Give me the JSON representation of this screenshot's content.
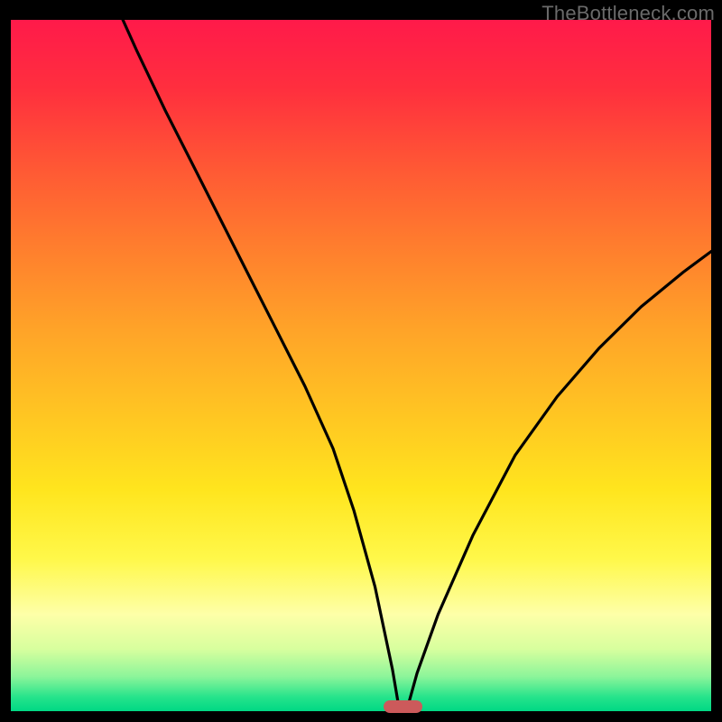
{
  "watermark": "TheBottleneck.com",
  "chart_data": {
    "type": "line",
    "title": "",
    "xlabel": "",
    "ylabel": "",
    "series": [
      {
        "name": "bottleneck-curve",
        "x": [
          0.0,
          0.05,
          0.1,
          0.14,
          0.18,
          0.22,
          0.26,
          0.3,
          0.34,
          0.38,
          0.42,
          0.46,
          0.49,
          0.52,
          0.545,
          0.555,
          0.565,
          0.58,
          0.61,
          0.66,
          0.72,
          0.78,
          0.84,
          0.9,
          0.96,
          1.0
        ],
        "values": [
          1.55,
          1.35,
          1.17,
          1.045,
          0.955,
          0.87,
          0.79,
          0.71,
          0.63,
          0.55,
          0.47,
          0.38,
          0.29,
          0.18,
          0.06,
          0.0,
          0.0,
          0.055,
          0.14,
          0.255,
          0.37,
          0.455,
          0.525,
          0.585,
          0.635,
          0.665
        ]
      }
    ],
    "xlim": [
      0,
      1
    ],
    "ylim": [
      0,
      1
    ],
    "minimum_marker": {
      "x": 0.56,
      "width": 0.055
    },
    "colors": {
      "curve": "#000000",
      "marker": "#cc5a5b",
      "gradient_top": "#ff1a4a",
      "gradient_bottom": "#00d884"
    }
  }
}
